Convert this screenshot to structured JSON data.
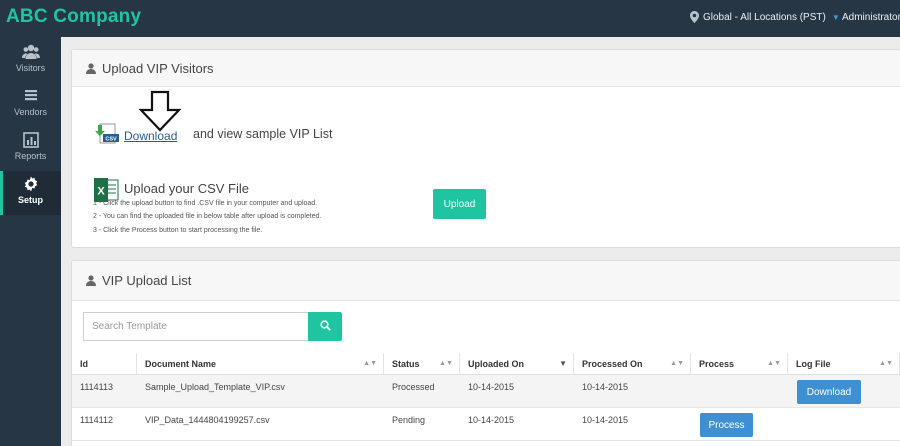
{
  "topbar": {
    "brand": "ABC Company",
    "location": "Global - All Locations (PST)",
    "user": "Administrator"
  },
  "sidebar": {
    "items": [
      {
        "label": "Visitors",
        "icon": "users-icon"
      },
      {
        "label": "Vendors",
        "icon": "list-icon"
      },
      {
        "label": "Reports",
        "icon": "bar-chart-icon"
      },
      {
        "label": "Setup",
        "icon": "gear-icon",
        "active": true
      }
    ]
  },
  "upload_panel": {
    "title": "Upload VIP Visitors",
    "download_link": "Download",
    "download_text": "and view sample VIP List",
    "upload_title": "Upload your CSV File",
    "instructions": [
      "1 - Click the upload button to find .CSV file in your computer and upload.",
      "2 - You can find the uploaded file in below table after upload is completed.",
      "3 - Click the Process button to start processing the file."
    ],
    "upload_button": "Upload"
  },
  "list_panel": {
    "title": "VIP Upload List",
    "search_placeholder": "Search Template",
    "columns": [
      "Id",
      "Document Name",
      "Status",
      "Uploaded On",
      "Processed On",
      "Process",
      "Log File"
    ],
    "rows": [
      {
        "id": "1114113",
        "document": "Sample_Upload_Template_VIP.csv",
        "status": "Processed",
        "uploaded": "10-14-2015",
        "processed": "10-14-2015",
        "process_button": "",
        "log_button": "Download"
      },
      {
        "id": "1114112",
        "document": "VIP_Data_1444804199257.csv",
        "status": "Pending",
        "uploaded": "10-14-2015",
        "processed": "10-14-2015",
        "process_button": "Process",
        "log_button": ""
      }
    ]
  },
  "colors": {
    "accent": "#1fc5a0",
    "nav_bg": "#263644",
    "button_blue": "#3f8fd3"
  }
}
